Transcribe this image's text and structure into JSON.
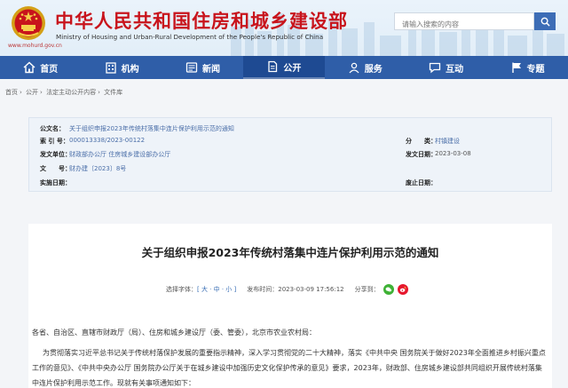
{
  "header": {
    "title_cn": "中华人民共和国住房和城乡建设部",
    "title_en": "Ministry of Housing and Urban-Rural Development of the People's Republic of China",
    "site_url": "www.mohurd.gov.cn",
    "search_placeholder": "请输入搜索的内容"
  },
  "nav": {
    "items": [
      {
        "label": "首页",
        "icon": "home-icon"
      },
      {
        "label": "机构",
        "icon": "building-icon"
      },
      {
        "label": "新闻",
        "icon": "news-icon"
      },
      {
        "label": "公开",
        "icon": "document-icon"
      },
      {
        "label": "服务",
        "icon": "service-icon"
      },
      {
        "label": "互动",
        "icon": "chat-icon"
      },
      {
        "label": "专题",
        "icon": "flag-icon"
      }
    ],
    "active_index": 3
  },
  "breadcrumb": [
    "首页",
    "公开",
    "法定主动公开内容",
    "文件库"
  ],
  "info": {
    "title_key": "公文名：",
    "title_val": "关于组织申报2023年传统村落集中连片保护利用示范的通知",
    "index_key": "索 引 号：",
    "index_val": "000013338/2023-00122",
    "issuer_key": "发文单位：",
    "issuer_val": "财政部办公厅 住房城乡建设部办公厅",
    "docno_key": "文　　号：",
    "docno_val": "财办建〔2023〕8号",
    "impl_key": "实施日期：",
    "category_key": "分　　类：",
    "category_val": "村镇建设",
    "date_key": "发文日期：",
    "date_val": "2023-03-08",
    "repeal_key": "废止日期："
  },
  "article": {
    "title": "关于组织申报2023年传统村落集中连片保护利用示范的通知",
    "font_size_label": "选择字体：",
    "font_size_options": "[ 大 · 中 · 小 ]",
    "publish_label": "发布时间：",
    "publish_time": "2023-03-09 17:56:12",
    "share_label": "分享到：",
    "para1": "各省、自治区、直辖市财政厅（局）、住房和城乡建设厅（委、管委），北京市农业农村局：",
    "para2": "为贯彻落实习近平总书记关于传统村落保护发展的重要指示精神，深入学习贯彻党的二十大精神，落实《中共中央 国务院关于做好2023年全面推进乡村振兴重点工作的意见》、《中共中央办公厅 国务院办公厅关于在城乡建设中加强历史文化保护传承的意见》要求，2023年，财政部、住房城乡建设部共同组织开展传统村落集中连片保护利用示范工作。现就有关事项通知如下："
  },
  "colors": {
    "brand_red": "#c8141c",
    "nav_blue": "#2f5ea8",
    "link_blue": "#4a6ea8"
  }
}
